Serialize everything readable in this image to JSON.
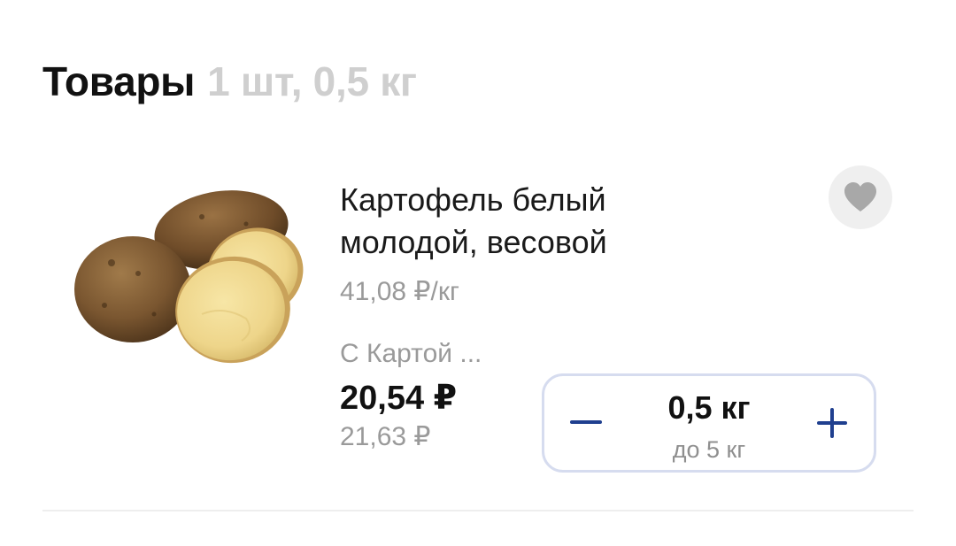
{
  "section": {
    "title": "Товары",
    "meta": "1 шт, 0,5 кг"
  },
  "product": {
    "name_line1": "Картофель белый",
    "name_line2": "молодой, весовой",
    "unit_price": "41,08 ₽/кг",
    "card_label": "С Картой ...",
    "price_current": "20,54 ₽",
    "price_old": "21,63 ₽",
    "image_icon": "potato-image",
    "favorite_icon": "heart-icon"
  },
  "stepper": {
    "quantity": "0,5 кг",
    "limit": "до 5 кг",
    "minus_icon": "minus-icon",
    "plus_icon": "plus-icon"
  },
  "colors": {
    "accent": "#1f3f8f",
    "muted_text": "#9a9a9a",
    "header_meta": "#cfcfcf",
    "stepper_border": "#d6dcef",
    "favorite_bg": "#efefef"
  }
}
